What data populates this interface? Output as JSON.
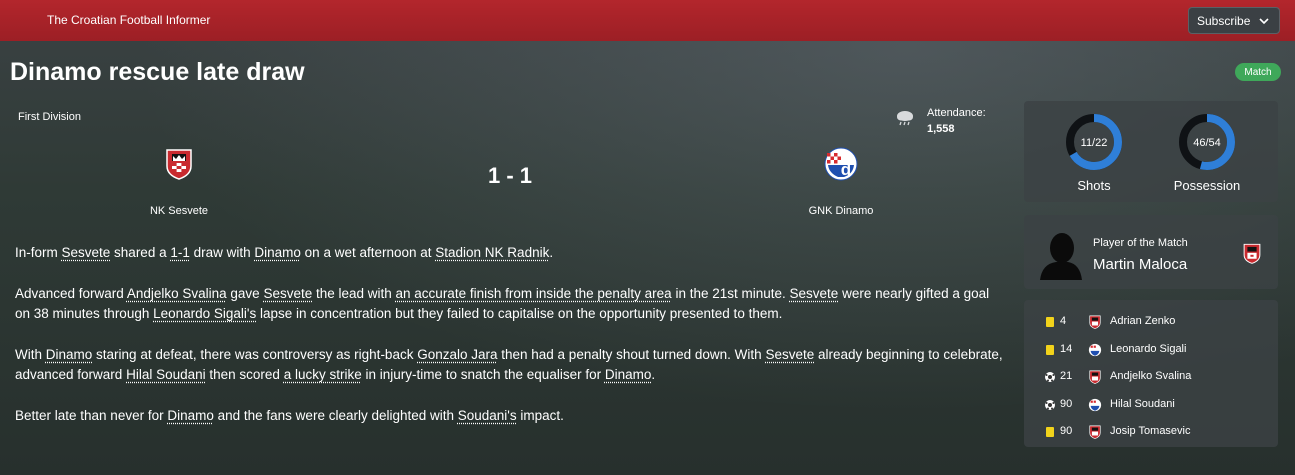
{
  "header": {
    "brand": "The Croatian Football Informer",
    "subscribe_label": "Subscribe"
  },
  "article": {
    "headline": "Dinamo rescue late draw",
    "tag": "Match"
  },
  "match": {
    "competition": "First Division",
    "attendance_label": "Attendance:",
    "attendance_value": "1,558",
    "weather_icon": "cloud-rain-icon",
    "home_team": "NK Sesvete",
    "away_team": "GNK Dinamo",
    "score": "1 - 1"
  },
  "story": {
    "p1": [
      {
        "t": "In-form "
      },
      {
        "t": "Sesvete",
        "u": true
      },
      {
        "t": " shared a "
      },
      {
        "t": "1-1",
        "u": true
      },
      {
        "t": " draw with "
      },
      {
        "t": "Dinamo",
        "u": true
      },
      {
        "t": " on a wet afternoon at "
      },
      {
        "t": "Stadion NK Radnik",
        "u": true
      },
      {
        "t": "."
      }
    ],
    "p2": [
      {
        "t": "Advanced forward "
      },
      {
        "t": "Andjelko Svalina",
        "u": true
      },
      {
        "t": " gave "
      },
      {
        "t": "Sesvete",
        "u": true
      },
      {
        "t": " the lead with "
      },
      {
        "t": "an accurate finish from inside the penalty area",
        "u": true
      },
      {
        "t": " in the 21st minute. "
      },
      {
        "t": "Sesvete",
        "u": true
      },
      {
        "t": " were nearly gifted a goal on 38 minutes through "
      },
      {
        "t": "Leonardo Sigali's",
        "u": true
      },
      {
        "t": " lapse in concentration but they failed to capitalise on the opportunity presented to them."
      }
    ],
    "p3": [
      {
        "t": "With "
      },
      {
        "t": "Dinamo",
        "u": true
      },
      {
        "t": " staring at defeat, there was controversy as right-back "
      },
      {
        "t": "Gonzalo Jara",
        "u": true
      },
      {
        "t": " then had a penalty shout turned down. With "
      },
      {
        "t": "Sesvete",
        "u": true
      },
      {
        "t": " already beginning to celebrate, advanced forward "
      },
      {
        "t": "Hilal Soudani",
        "u": true
      },
      {
        "t": " then scored "
      },
      {
        "t": "a lucky strike",
        "u": true
      },
      {
        "t": " in injury-time to snatch the equaliser for "
      },
      {
        "t": "Dinamo",
        "u": true
      },
      {
        "t": "."
      }
    ],
    "p4": [
      {
        "t": "Better late than never for "
      },
      {
        "t": "Dinamo",
        "u": true
      },
      {
        "t": " and the fans were clearly delighted with "
      },
      {
        "t": "Soudani's",
        "u": true
      },
      {
        "t": " impact."
      }
    ]
  },
  "stats": {
    "shots": {
      "label": "Shots",
      "text": "11/22",
      "home": 11,
      "away": 22
    },
    "possession": {
      "label": "Possession",
      "text": "46/54",
      "home": 46,
      "away": 54
    },
    "colors": {
      "home": "#0f1215",
      "away": "#2f7fd8"
    }
  },
  "potm": {
    "label": "Player of the Match",
    "name": "Martin Maloca"
  },
  "events": [
    {
      "type": "yellow-card-icon",
      "minute": "4",
      "team": "home",
      "player": "Adrian Zenko"
    },
    {
      "type": "yellow-card-icon",
      "minute": "14",
      "team": "away",
      "player": "Leonardo Sigali"
    },
    {
      "type": "goal-ball-icon",
      "minute": "21",
      "team": "home",
      "player": "Andjelko Svalina"
    },
    {
      "type": "goal-ball-icon",
      "minute": "90",
      "team": "away",
      "player": "Hilal Soudani"
    },
    {
      "type": "yellow-card-icon",
      "minute": "90",
      "team": "home",
      "player": "Josip Tomasevic"
    }
  ]
}
